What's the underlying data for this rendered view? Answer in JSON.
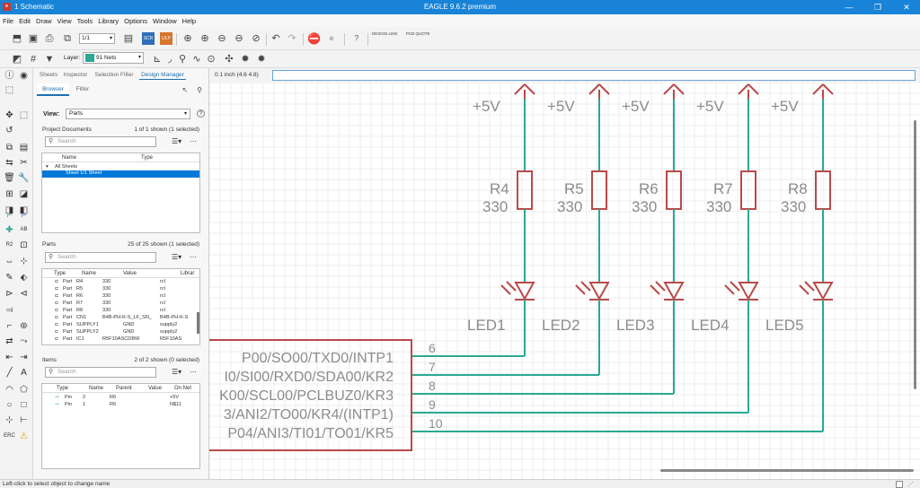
{
  "window": {
    "doc_title": "1 Schematic",
    "app_title": "EAGLE 9.6.2 premium",
    "minimize": "—",
    "maximize": "❐",
    "close": "✕"
  },
  "menu": [
    "File",
    "Edit",
    "Draw",
    "View",
    "Tools",
    "Library",
    "Options",
    "Window",
    "Help"
  ],
  "toolbar": {
    "sheet_value": "1/1",
    "design_link": "DESIGN LINK",
    "pcb_quote": "PCB QUOTE",
    "layer_label": "Layer:",
    "layer_value": "91 Nets",
    "layer_color": "#2aa893"
  },
  "panel": {
    "tabs": [
      "Sheets",
      "Inspector",
      "Selection Filter",
      "Design Manager"
    ],
    "subtabs": [
      "Browser",
      "Filter"
    ],
    "view_label": "View:",
    "view_value": "Parts",
    "help": "?",
    "project_docs": {
      "label": "Project Documents",
      "count": "1 of 1 shown (1 selected)",
      "search_placeholder": "Search",
      "headers": [
        "Name",
        "Type"
      ],
      "rows": [
        {
          "name": "All Sheets"
        },
        {
          "name": "Sheet 1/1 Sheet"
        }
      ]
    },
    "parts": {
      "label": "Parts",
      "count": "25 of 25 shown (1 selected)",
      "search_placeholder": "Search",
      "headers": [
        "Type",
        "Name",
        "Value",
        "Librar"
      ],
      "rows": [
        {
          "type": "Part",
          "name": "R4",
          "value": "330",
          "lib": "rcl"
        },
        {
          "type": "Part",
          "name": "R5",
          "value": "330",
          "lib": "rcl"
        },
        {
          "type": "Part",
          "name": "R6",
          "value": "330",
          "lib": "rcl"
        },
        {
          "type": "Part",
          "name": "R7",
          "value": "330",
          "lib": "rcl"
        },
        {
          "type": "Part",
          "name": "R8",
          "value": "330",
          "lib": "rcl"
        },
        {
          "type": "Part",
          "name": "CN1",
          "value": "B4B-PH-K-S_LF_SN_",
          "lib": "B4B-PH-K-S"
        },
        {
          "type": "Part",
          "name": "SUPPLY1",
          "value": "GND",
          "lib": "supply2"
        },
        {
          "type": "Part",
          "name": "SUPPLY2",
          "value": "GND",
          "lib": "supply2"
        },
        {
          "type": "Part",
          "name": "IC1",
          "value": "R5F10ASCDBW",
          "lib": "R5F10AS"
        }
      ]
    },
    "items": {
      "label": "Items",
      "count": "2 of 2 shown (0 selected)",
      "search_placeholder": "Search",
      "headers": [
        "Type",
        "Name",
        "Parent",
        "Value",
        "On Net"
      ],
      "rows": [
        {
          "type": "Pin",
          "name": "2",
          "parent": "R6",
          "value": "",
          "net": "+5V"
        },
        {
          "type": "Pin",
          "name": "1",
          "parent": "R6",
          "value": "",
          "net": "N$11"
        }
      ]
    }
  },
  "command": {
    "coordinate": "0.1 inch (4.6 4.8)",
    "input_value": ""
  },
  "schematic": {
    "supply_label": "+5V",
    "resistors": [
      {
        "name": "R4",
        "value": "330"
      },
      {
        "name": "R5",
        "value": "330"
      },
      {
        "name": "R6",
        "value": "330"
      },
      {
        "name": "R7",
        "value": "330"
      },
      {
        "name": "R8",
        "value": "330"
      }
    ],
    "leds": [
      "LED1",
      "LED2",
      "LED3",
      "LED4",
      "LED5"
    ],
    "ic_pins": [
      {
        "name": "P00/SO00/TXD0/INTP1",
        "number": "6"
      },
      {
        "name": "I0/SI00/RXD0/SDA00/KR2",
        "number": "7"
      },
      {
        "name": "K00/SCL00/PCLBUZ0/KR3",
        "number": "8"
      },
      {
        "name": "3/ANI2/TO00/KR4/(INTP1)",
        "number": "9"
      },
      {
        "name": "P04/ANI3/TI01/TO01/KR5",
        "number": "10"
      }
    ],
    "symbol_color": "#b94a4a",
    "net_color": "#2aa893",
    "text_color": "#8c8c8c"
  },
  "status": {
    "message": "Left-click to select object to change name"
  }
}
